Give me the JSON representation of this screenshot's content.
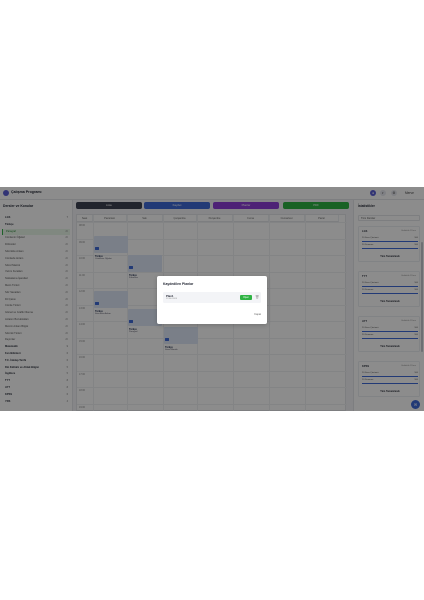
{
  "app": {
    "title": "Çalışma Programı",
    "user": "Merve"
  },
  "sidebar": {
    "header": "Dersler ve Konular",
    "items": [
      {
        "label": "LGS",
        "kind": "group",
        "count": "7"
      },
      {
        "label": "Türkçe",
        "kind": "group",
        "count": ""
      },
      {
        "label": "Paragraf",
        "kind": "selected",
        "count": "20"
      },
      {
        "label": "Cümlenin Öğeleri",
        "kind": "item",
        "count": "20"
      },
      {
        "label": "Fiilimsiler",
        "kind": "item",
        "count": "20"
      },
      {
        "label": "Sözcükte Anlam",
        "kind": "item",
        "count": "20"
      },
      {
        "label": "Cümlede Anlam",
        "kind": "item",
        "count": "20"
      },
      {
        "label": "Sözel Mantık",
        "kind": "item",
        "count": "20"
      },
      {
        "label": "Yazım Kuralları",
        "kind": "item",
        "count": "20"
      },
      {
        "label": "Noktalama İşaretleri",
        "kind": "item",
        "count": "20"
      },
      {
        "label": "Metin Türleri",
        "kind": "item",
        "count": "20"
      },
      {
        "label": "Söz Sanatları",
        "kind": "item",
        "count": "20"
      },
      {
        "label": "Fiil Çatısı",
        "kind": "item",
        "count": "20"
      },
      {
        "label": "Cümle Türleri",
        "kind": "item",
        "count": "20"
      },
      {
        "label": "Görsel ve Grafik Okuma",
        "kind": "item",
        "count": "20"
      },
      {
        "label": "Anlatım Bozuklukları",
        "kind": "item",
        "count": "20"
      },
      {
        "label": "Metnin Anlam Bilgisi",
        "kind": "item",
        "count": "20"
      },
      {
        "label": "Sözcük Türleri",
        "kind": "item",
        "count": "20"
      },
      {
        "label": "Deyimler",
        "kind": "item",
        "count": "20"
      },
      {
        "label": "Matematik",
        "kind": "group",
        "count": "9"
      },
      {
        "label": "Fen Bilimleri",
        "kind": "group",
        "count": "6"
      },
      {
        "label": "T.C. İnkılap Tarihi",
        "kind": "group",
        "count": "6"
      },
      {
        "label": "Din Kültürü ve Ahlak Bilgisi",
        "kind": "group",
        "count": "5"
      },
      {
        "label": "İngilizce",
        "kind": "group",
        "count": "5"
      },
      {
        "label": "TYT",
        "kind": "group",
        "count": "8"
      },
      {
        "label": "AYT",
        "kind": "group",
        "count": "8"
      },
      {
        "label": "KPSS",
        "kind": "group",
        "count": "6"
      },
      {
        "label": "YDS",
        "kind": "group",
        "count": "4"
      }
    ]
  },
  "tabs": [
    {
      "label": "Liste",
      "color": "#3d4252"
    },
    {
      "label": "Kaydet",
      "color": "#3f6ad8"
    },
    {
      "label": "Planlar",
      "color": "#8f3fd8"
    },
    {
      "label": "PDF",
      "color": "#2fb344"
    }
  ],
  "grid": {
    "time_header": "Saat",
    "days": [
      "Pazartesi",
      "Salı",
      "Çarşamba",
      "Perşembe",
      "Cuma",
      "Cumartesi",
      "Pazar"
    ],
    "hours": [
      "08:00",
      "09:00",
      "10:00",
      "11:00",
      "12:00",
      "13:00",
      "14:00",
      "15:00",
      "16:00",
      "17:00",
      "18:00",
      "19:00"
    ],
    "lessons": [
      {
        "tag": "20",
        "name": "Türkçe",
        "topic": "Cümlenin Öğeleri"
      },
      {
        "tag": "20",
        "name": "Türkçe",
        "topic": "Fiilimsiler"
      },
      {
        "tag": "20",
        "name": "Türkçe",
        "topic": "Sözcükte Anlam"
      },
      {
        "tag": "20",
        "name": "Türkçe",
        "topic": "Paragraf"
      },
      {
        "tag": "20",
        "name": "Türkçe",
        "topic": "Sözel Mantık"
      }
    ]
  },
  "right_panel": {
    "header": "İstatistikler",
    "filter": "Tüm Dersler",
    "cards": [
      {
        "name": "LGS",
        "hours": "Haftalık 4 Ders",
        "row1": "20 Soru Çözümü",
        "v1": "100",
        "row2": "20 Deneme",
        "v2": "100",
        "footer": "Tüm Tamamlandı"
      },
      {
        "name": "TYT",
        "hours": "Haftalık 4 Ders",
        "row1": "20 Soru Çözümü",
        "v1": "100",
        "row2": "20 Deneme",
        "v2": "100",
        "footer": "Tüm Tamamlandı"
      },
      {
        "name": "AYT",
        "hours": "Haftalık 4 Ders",
        "row1": "20 Soru Çözümü",
        "v1": "100",
        "row2": "20 Deneme",
        "v2": "100",
        "footer": "Tüm Tamamlandı"
      },
      {
        "name": "KPSS",
        "hours": "Haftalık 4 Ders",
        "row1": "20 Soru Çözümü",
        "v1": "100",
        "row2": "20 Deneme",
        "v2": "100",
        "footer": "Tüm Tamamlandı"
      }
    ]
  },
  "modal": {
    "title": "Kaydedilen Planlar",
    "plan_name": "Plan1",
    "plan_date": "12.06.2024",
    "open_label": "Open",
    "close_label": "Kapat"
  }
}
